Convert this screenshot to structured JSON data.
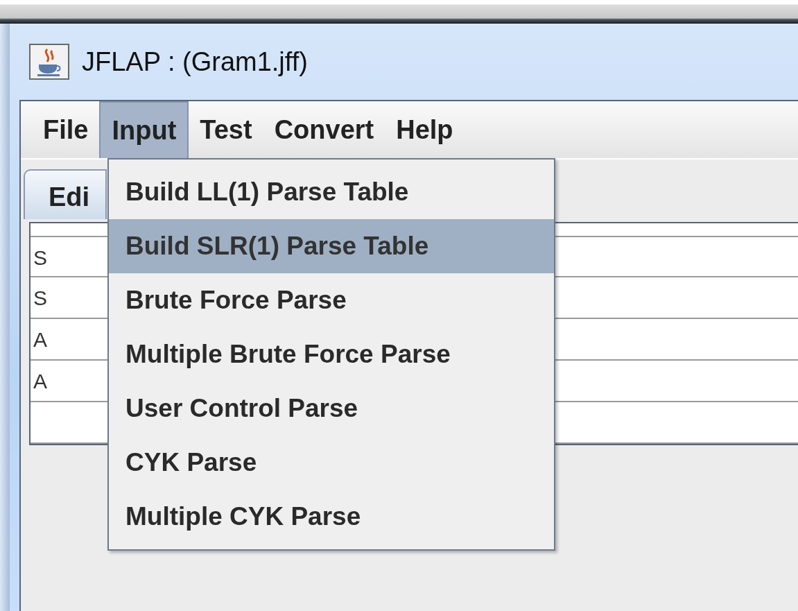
{
  "window": {
    "title": "JFLAP : (Gram1.jff)"
  },
  "menu_bar": [
    {
      "label": "File",
      "selected": false
    },
    {
      "label": "Input",
      "selected": true
    },
    {
      "label": "Test",
      "selected": false
    },
    {
      "label": "Convert",
      "selected": false
    },
    {
      "label": "Help",
      "selected": false
    }
  ],
  "tabs": [
    {
      "label": "Edi",
      "selected": true
    }
  ],
  "grammar_rows": [
    {
      "lhs": "S"
    },
    {
      "lhs": "S"
    },
    {
      "lhs": "A"
    },
    {
      "lhs": "A"
    }
  ],
  "dropdown": {
    "items": [
      {
        "label": "Build LL(1) Parse Table",
        "selected": false
      },
      {
        "label": "Build SLR(1) Parse Table",
        "selected": true
      },
      {
        "label": "Brute Force Parse",
        "selected": false
      },
      {
        "label": "Multiple Brute Force Parse",
        "selected": false
      },
      {
        "label": "User Control Parse",
        "selected": false
      },
      {
        "label": "CYK Parse",
        "selected": false
      },
      {
        "label": "Multiple CYK Parse",
        "selected": false
      }
    ]
  }
}
